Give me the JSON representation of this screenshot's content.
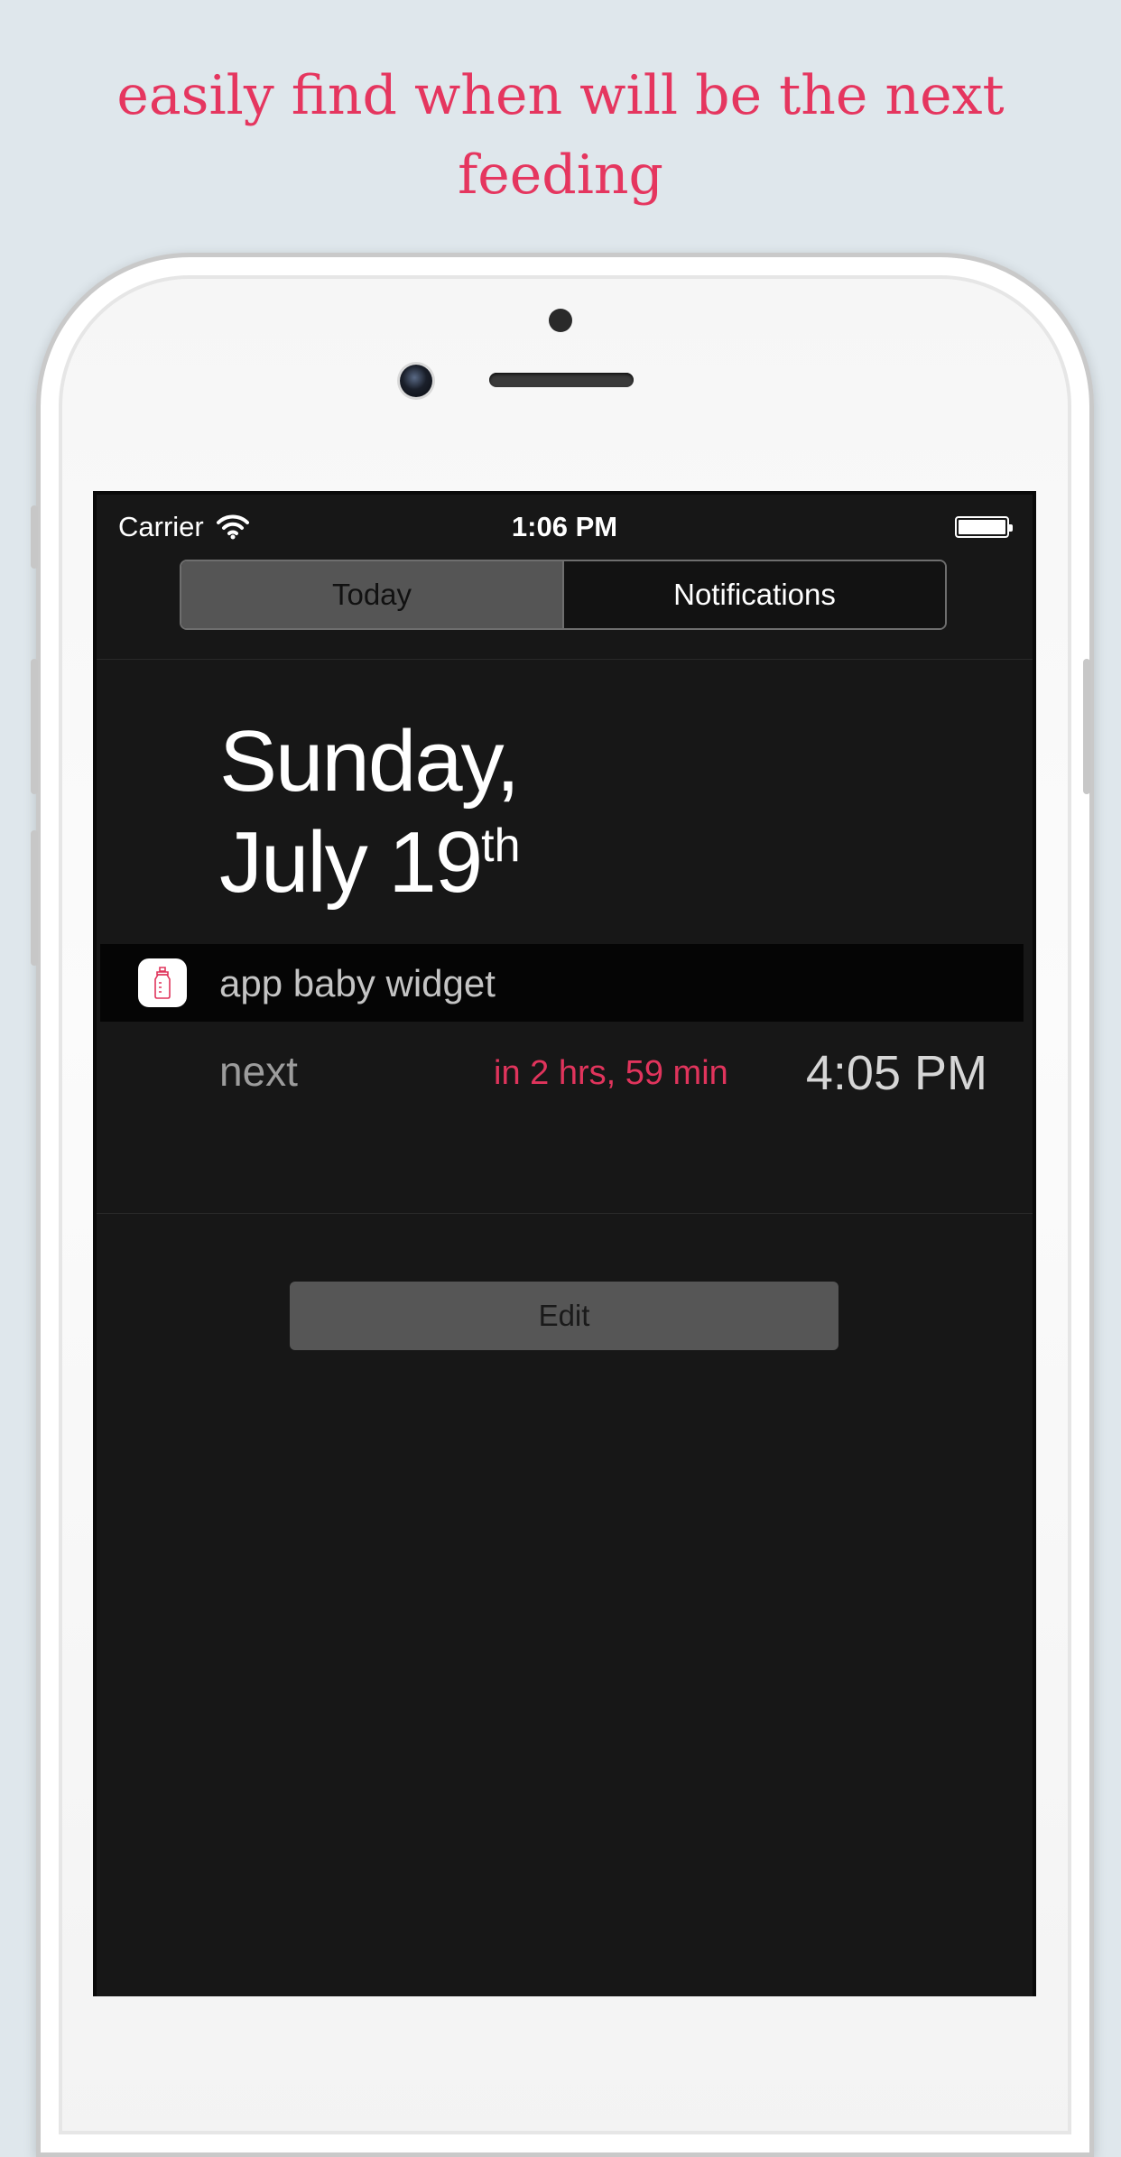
{
  "headline": "easily find when will be the next feeding",
  "status_bar": {
    "carrier": "Carrier",
    "time": "1:06 PM"
  },
  "segmented_control": {
    "items": [
      {
        "label": "Today",
        "selected": true
      },
      {
        "label": "Notifications",
        "selected": false
      }
    ]
  },
  "date": {
    "weekday": "Sunday,",
    "month_day": "July 19",
    "ordinal_suffix": "th"
  },
  "widget": {
    "name": "app baby widget",
    "icon": "baby-bottle-icon",
    "next_label": "next",
    "countdown": "in 2 hrs, 59 min",
    "next_time": "4:05 PM"
  },
  "edit_label": "Edit",
  "colors": {
    "accent": "#e0345c",
    "background": "#dfe7ec",
    "screen": "#171717"
  }
}
